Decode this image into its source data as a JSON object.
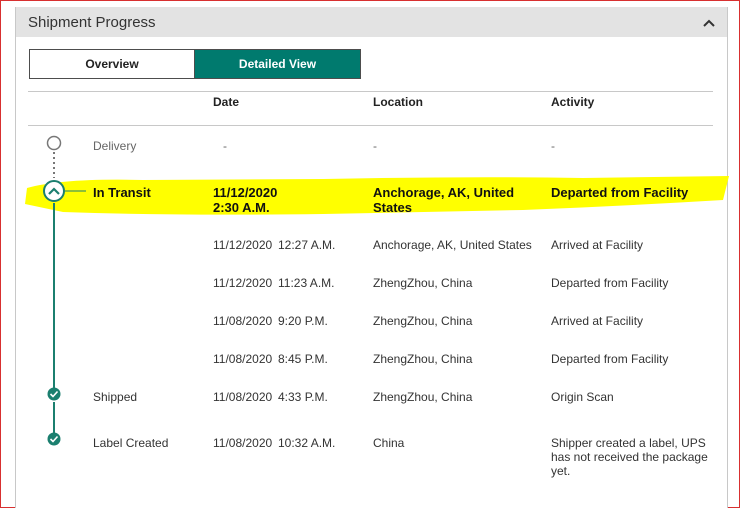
{
  "panel": {
    "title": "Shipment Progress",
    "collapse_icon": "chevron-up-icon"
  },
  "view_toggle": {
    "overview_label": "Overview",
    "detailed_label": "Detailed View",
    "active": "Detailed View"
  },
  "table": {
    "headers": {
      "date": "Date",
      "location": "Location",
      "activity": "Activity"
    },
    "rows": {
      "delivery": {
        "status": "Delivery",
        "date": "-",
        "location": "-",
        "activity": "-"
      },
      "in_transit": {
        "status": "In Transit",
        "date_line1": "11/12/2020",
        "date_line2": "2:30 A.M.",
        "location_line1": "Anchorage, AK, United",
        "location_line2": "States",
        "activity": "Departed from Facility"
      },
      "e1": {
        "date": "11/12/2020",
        "time": "12:27 A.M.",
        "location": "Anchorage, AK, United States",
        "activity": "Arrived at Facility"
      },
      "e2": {
        "date": "11/12/2020",
        "time": "11:23 A.M.",
        "location": "ZhengZhou, China",
        "activity": "Departed from Facility"
      },
      "e3": {
        "date": "11/08/2020",
        "time": "9:20 P.M.",
        "location": "ZhengZhou, China",
        "activity": "Arrived at Facility"
      },
      "e4": {
        "date": "11/08/2020",
        "time": "8:45 P.M.",
        "location": "ZhengZhou, China",
        "activity": "Departed from Facility"
      },
      "shipped": {
        "status": "Shipped",
        "date": "11/08/2020",
        "time": "4:33 P.M.",
        "location": "ZhengZhou, China",
        "activity": "Origin Scan"
      },
      "label_created": {
        "status": "Label Created",
        "date": "11/08/2020",
        "time": "10:32 A.M.",
        "location": "China",
        "activity_line1": "Shipper created a label, UPS",
        "activity_line2": "has not received the package",
        "activity_line3": "yet."
      }
    }
  },
  "colors": {
    "accent": "#007a6e",
    "highlight": "#ffff00",
    "check": "#1b7f6f"
  }
}
